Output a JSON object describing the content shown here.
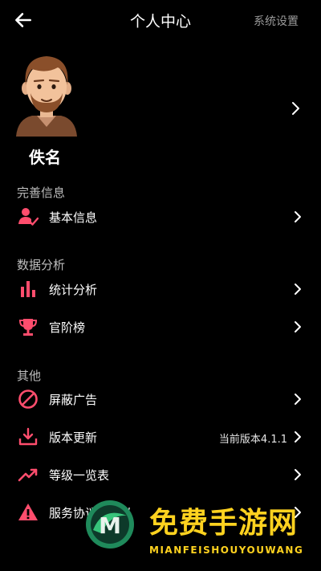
{
  "header": {
    "title": "个人中心",
    "settings": "系统设置"
  },
  "profile": {
    "name": "佚名"
  },
  "sections": {
    "info": "完善信息",
    "analysis": "数据分析",
    "other": "其他"
  },
  "items": {
    "basic_info": "基本信息",
    "stats": "统计分析",
    "ranking": "官阶榜",
    "block_ads": "屏蔽广告",
    "update": "版本更新",
    "update_value": "当前版本4.1.1",
    "levels": "等级一览表",
    "agreement": "服务协议与隐私"
  },
  "watermark": {
    "title": "免费手游网",
    "subtitle": "MIANFEISHOUYOUWANG",
    "logo_letter": "M"
  },
  "colors": {
    "accent": "#ff4d6d",
    "background": "#000000",
    "watermark": "#ffd21f"
  }
}
